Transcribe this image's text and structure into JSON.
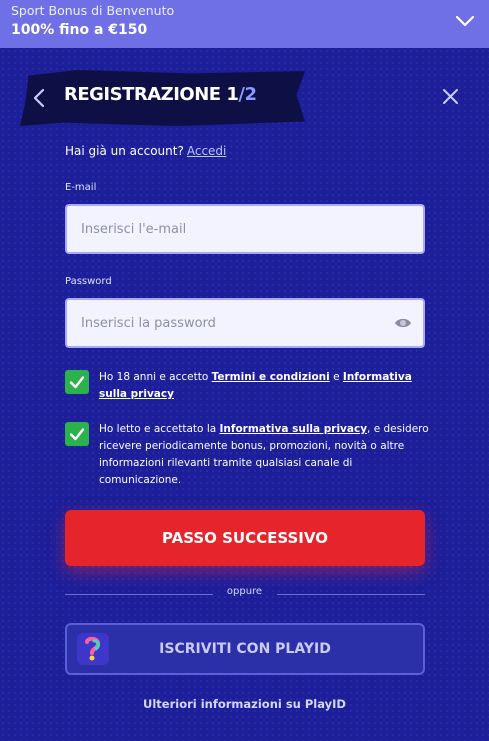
{
  "banner": {
    "subtitle": "Sport Bonus di Benvenuto",
    "title": "100% fino a €150",
    "chevron_icon": "chevron-down-icon"
  },
  "header": {
    "title": "REGISTRAZIONE 1",
    "step_separator": "/",
    "step_total": "2",
    "back_icon": "chevron-left-icon",
    "close_icon": "close-icon"
  },
  "account": {
    "prompt": "Hai già un account?",
    "login_link": "Accedi"
  },
  "email": {
    "label": "E-mail",
    "placeholder": "Inserisci l'e-mail",
    "value": ""
  },
  "password": {
    "label": "Password",
    "placeholder": "Inserisci la password",
    "value": "",
    "toggle_icon": "eye-icon"
  },
  "consents": {
    "terms": {
      "checked": true,
      "text_before": "Ho 18 anni e accetto",
      "link1": "Termini e condizioni",
      "text_middle": "e",
      "link2": "Informativa sulla privacy"
    },
    "marketing": {
      "checked": true,
      "text_before": "Ho letto e accettato la",
      "link": "Informativa sulla privacy",
      "text_after": ", e desidero ricevere periodicamente bonus, promozioni, novità o altre informazioni rilevanti tramite qualsiasi canale di comunicazione."
    }
  },
  "actions": {
    "next_label": "PASSO SUCCESSIVO",
    "or_label": "oppure",
    "playid_label": "ISCRIVITI CON PLAYID",
    "playid_icon": "playid-logo-icon",
    "more_info": "Ulteriori informazioni su PlayID"
  },
  "colors": {
    "background": "#1c1e9a",
    "banner": "#6f6fe6",
    "primary": "#e5242b",
    "checkbox": "#2bb24d",
    "link": "#b7c3ff"
  }
}
